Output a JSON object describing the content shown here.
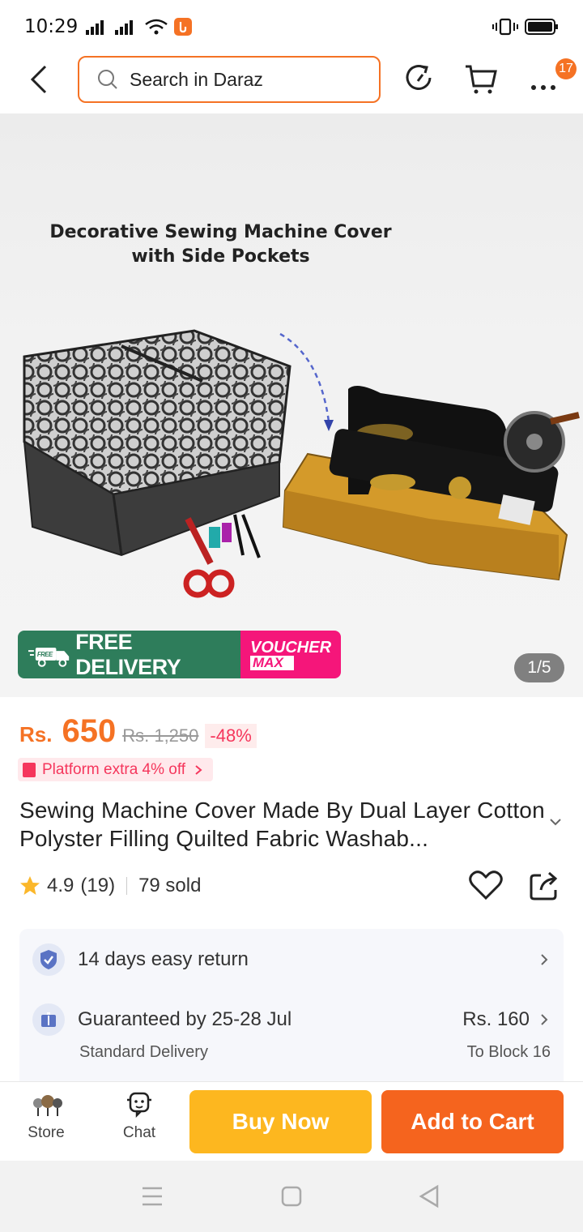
{
  "status": {
    "time": "10:29"
  },
  "search": {
    "placeholder": "Search in Daraz"
  },
  "header": {
    "menu_badge": "17"
  },
  "hero": {
    "line1": "Decorative Sewing Machine Cover",
    "line2": "with Side Pockets",
    "free_small": "FREE",
    "free_delivery": "FREE DELIVERY",
    "voucher": "VOUCHER",
    "voucher_max": "MAX",
    "pager": "1/5"
  },
  "price": {
    "currency": "Rs.",
    "value": "650",
    "original": "Rs. 1,250",
    "discount": "-48%",
    "platform_offer": "Platform extra 4% off"
  },
  "product": {
    "title": "Sewing Machine Cover Made By Dual Layer Cotton Polyster Filling Quilted Fabric Washab...",
    "rating": "4.9",
    "reviews": "(19)",
    "sold": "79 sold"
  },
  "delivery": {
    "return_policy": "14 days easy return",
    "guarantee": "Guaranteed by 25-28 Jul",
    "type": "Standard Delivery",
    "fee": "Rs. 160",
    "destination": "To Block 16"
  },
  "actions": {
    "store": "Store",
    "chat": "Chat",
    "buy_now": "Buy Now",
    "add_to_cart": "Add to Cart"
  },
  "colors": {
    "accent": "#f57224",
    "buy": "#fdb71f",
    "cart": "#f5641e",
    "free_green": "#2e7d5b",
    "voucher_pink": "#f5167a"
  }
}
